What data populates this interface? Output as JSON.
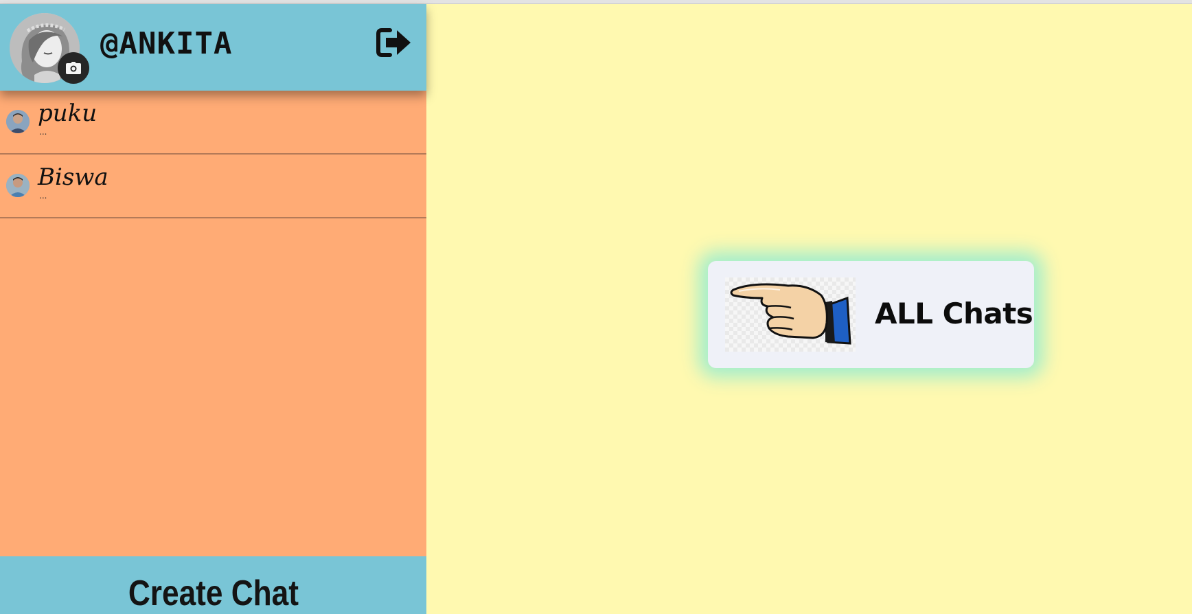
{
  "user": {
    "handle": "@ANKITA",
    "avatar_icon": "user-avatar-icon",
    "camera_icon": "camera-icon"
  },
  "header": {
    "logout_icon": "sign-out-icon"
  },
  "chats": [
    {
      "name": "puku",
      "preview": "..."
    },
    {
      "name": "Biswa",
      "preview": "..."
    }
  ],
  "footer": {
    "create_chat_label": "Create Chat"
  },
  "main": {
    "prompt_label": "ALL Chats",
    "prompt_icon": "pointing-hand-icon"
  },
  "colors": {
    "sidebar_bg": "#ffab75",
    "header_bg": "#79c5d6",
    "main_bg": "#fff9b0",
    "card_glow": "#9aecce"
  }
}
